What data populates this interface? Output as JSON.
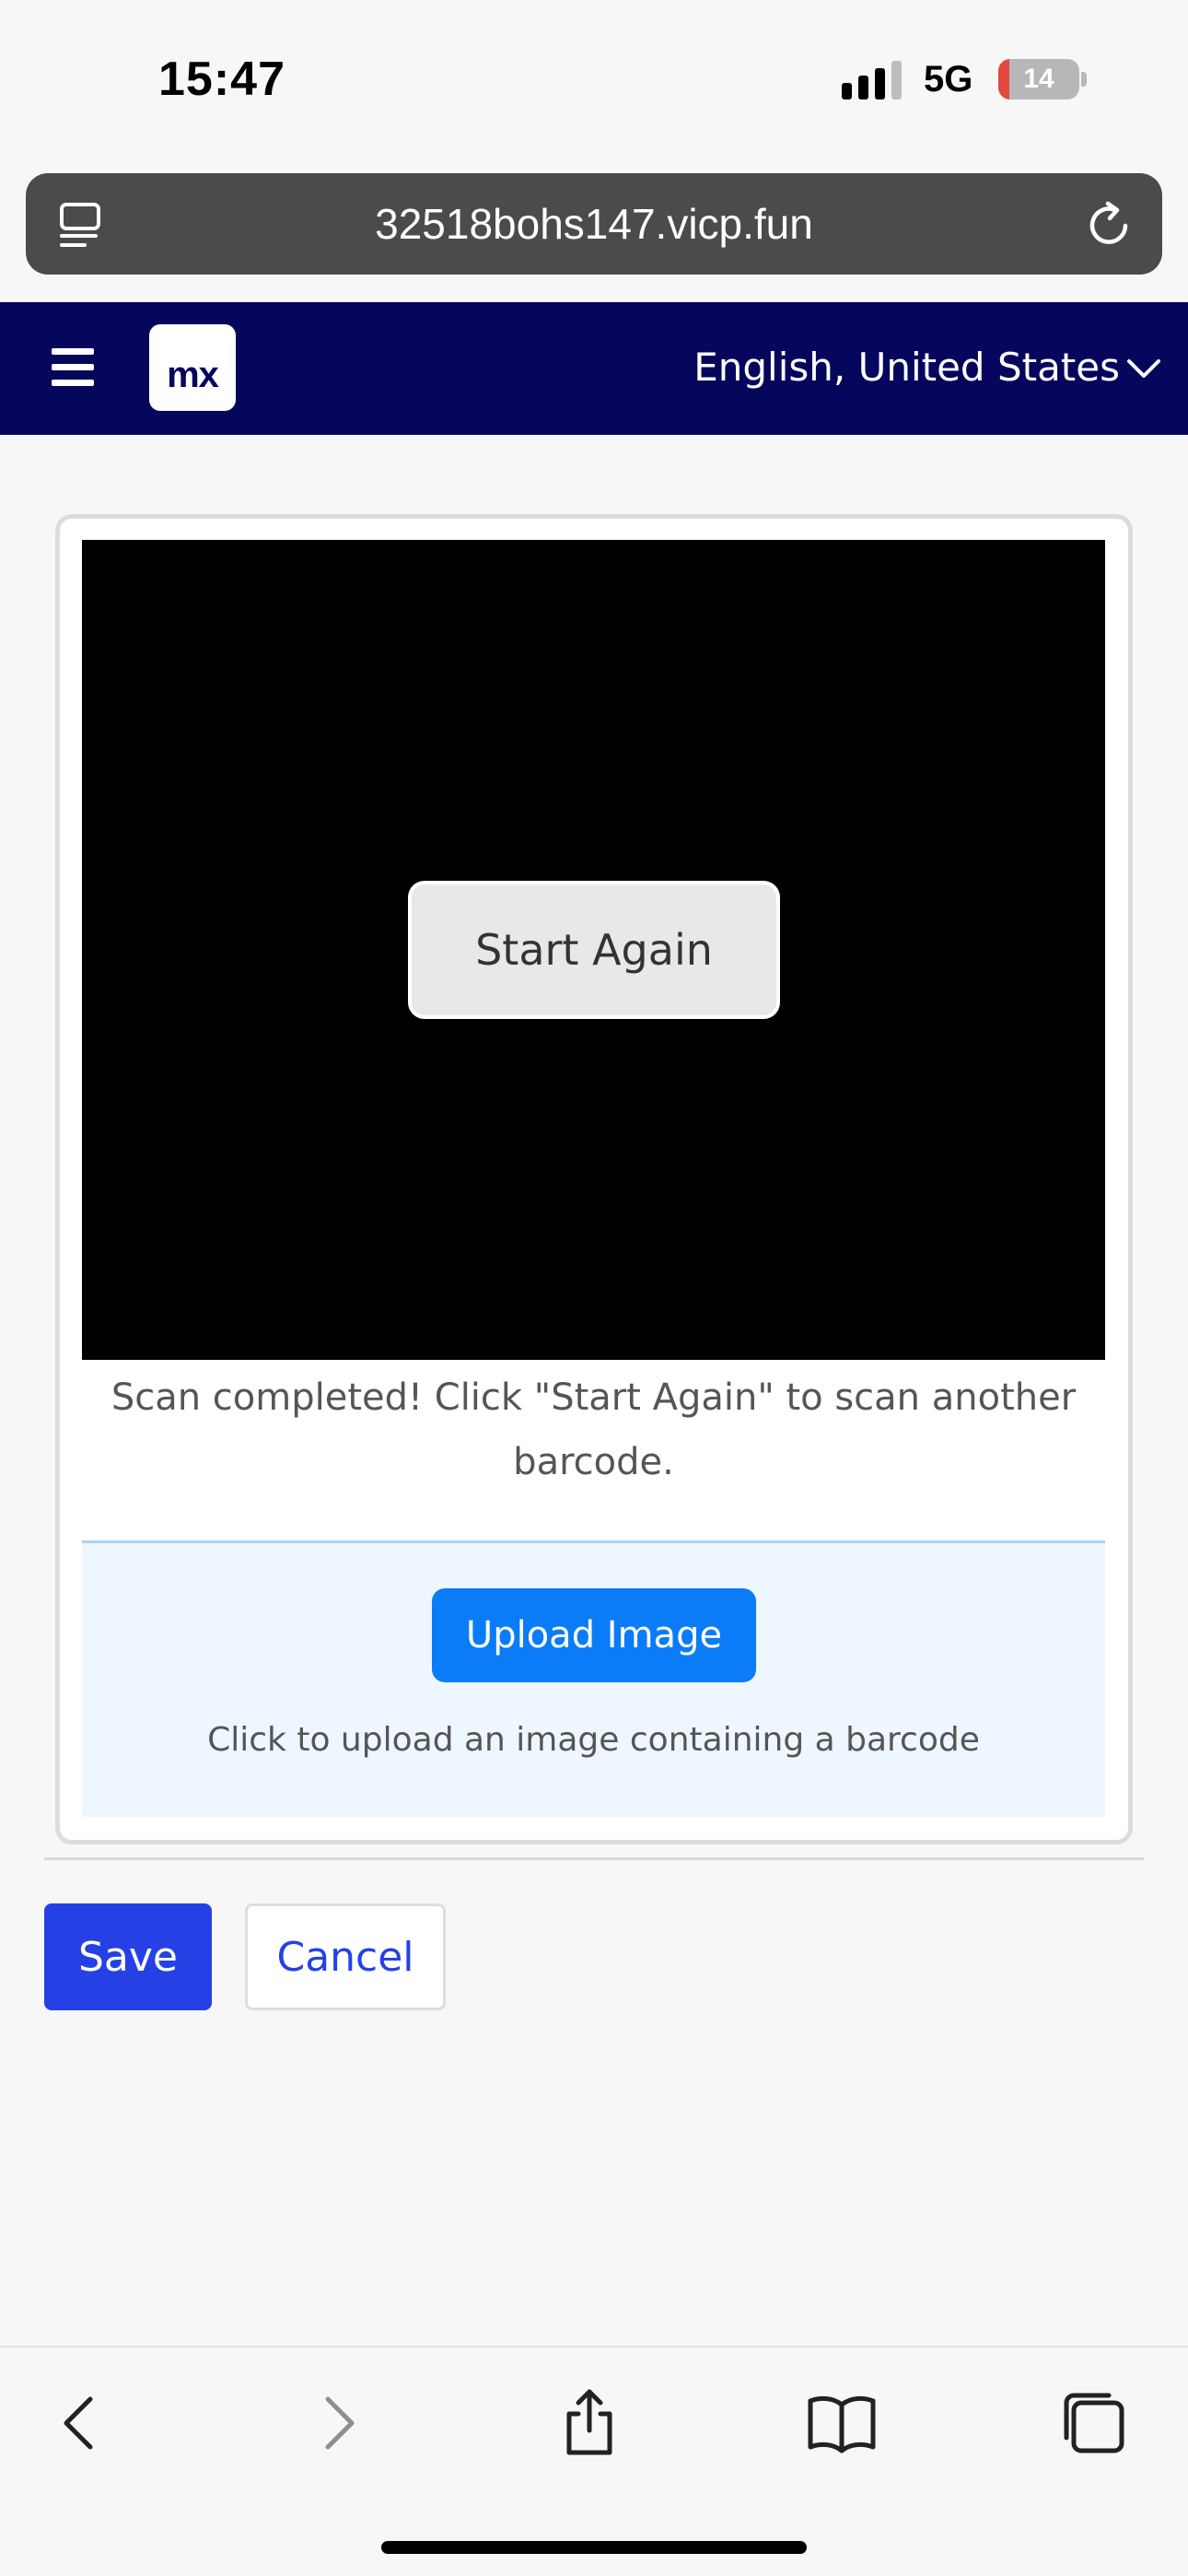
{
  "status_bar": {
    "time": "15:47",
    "network": "5G",
    "battery_level": "14",
    "battery_fill_fraction": 0.14,
    "battery_accent": "#e5483e"
  },
  "browser": {
    "url": "32518bohs147.vicp.fun",
    "left_icon": "page-settings-icon",
    "reload_icon": "reload-icon"
  },
  "header": {
    "background": "#05065c",
    "menu_icon": "hamburger-icon",
    "logo_text": "mx",
    "language": "English, United States"
  },
  "scanner": {
    "start_again_label": "Start Again",
    "status_message": "Scan completed! Click \"Start Again\" to scan another barcode."
  },
  "upload": {
    "button_label": "Upload Image",
    "hint": "Click to upload an image containing a barcode",
    "accent": "#0b7cf7"
  },
  "form_actions": {
    "save_label": "Save",
    "cancel_label": "Cancel",
    "primary_color": "#2541e5"
  },
  "toolbar": {
    "icons": [
      "back-icon",
      "forward-icon",
      "share-icon",
      "bookmarks-icon",
      "tabs-icon"
    ]
  }
}
